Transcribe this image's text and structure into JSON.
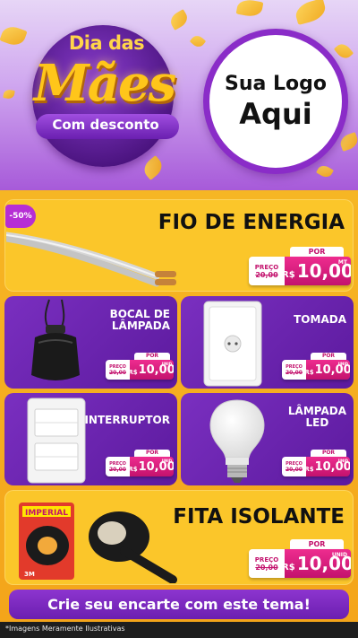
{
  "header": {
    "hero_line1": "Dia das",
    "hero_line2": "Mães",
    "hero_line3": "Com desconto",
    "logo_line1": "Sua Logo",
    "logo_line2": "Aqui"
  },
  "discount_badge": "-50%",
  "price_labels": {
    "por": "POR",
    "preco": "PREÇO",
    "currency": "R$"
  },
  "products": [
    {
      "name": "FIO DE ENERGIA",
      "old_price": "20,00",
      "price": "10,00",
      "unit": "MT",
      "image": "wire-image"
    },
    {
      "name_line1": "BOCAL DE",
      "name_line2": "LÂMPADA",
      "old_price": "20,00",
      "price": "10,00",
      "unit": "UNID",
      "image": "socket-image"
    },
    {
      "name": "TOMADA",
      "old_price": "20,00",
      "price": "10,00",
      "unit": "UNID",
      "image": "outlet-image"
    },
    {
      "name": "INTERRUPTOR",
      "old_price": "20,00",
      "price": "10,00",
      "unit": "UNID",
      "image": "switch-image"
    },
    {
      "name_line1": "LÂMPADA",
      "name_line2": "LED",
      "old_price": "20,00",
      "price": "10,00",
      "unit": "UNID",
      "image": "bulb-image"
    },
    {
      "name": "FITA ISOLANTE",
      "old_price": "20,00",
      "price": "10,00",
      "unit": "UNID",
      "image": "tape-image",
      "brand": "IMPERIAL",
      "brand2": "3M"
    }
  ],
  "cta": "Crie seu encarte com este tema!",
  "footer": "*Imagens Meramente Ilustrativas",
  "colors": {
    "purple": "#6b1fb0",
    "yellow": "#fbc62a",
    "pink": "#c3126d",
    "orange": "#f4a41a"
  }
}
